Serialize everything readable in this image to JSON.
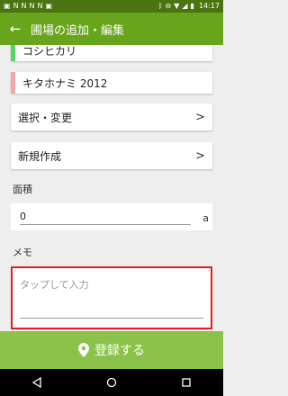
{
  "status_bar": {
    "time": "14:17",
    "left_icons": [
      "notification-icon",
      "notification-icon",
      "notification-icon",
      "notification-icon",
      "notification-icon",
      "notification-icon"
    ],
    "right_icons": [
      "bluetooth-icon",
      "minus-circle-icon",
      "wifi-icon",
      "signal-icon",
      "battery-icon"
    ]
  },
  "app_bar": {
    "title": "圃場の追加・編集"
  },
  "crops": [
    {
      "label": "コシヒカリ",
      "color": "#4cd964"
    },
    {
      "label": "キタホナミ 2012",
      "color": "#f4a7a7"
    }
  ],
  "actions": {
    "select_change": "選択・変更",
    "create_new": "新規作成",
    "chevron": ">"
  },
  "area": {
    "label": "面積",
    "value": "0",
    "unit": "a"
  },
  "memo": {
    "label": "メモ",
    "placeholder": "タップして入力",
    "value": ""
  },
  "register_button": {
    "label": "登録する"
  },
  "colors": {
    "app_bar": "#69a51c",
    "status_bar": "#4b7312",
    "register": "#8bc34a",
    "highlight": "#e31b23"
  }
}
